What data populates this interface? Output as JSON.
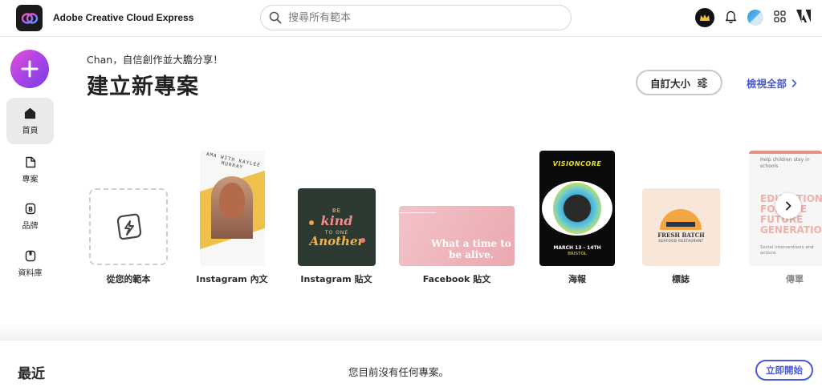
{
  "app": {
    "title": "Adobe Creative Cloud Express"
  },
  "search": {
    "placeholder": "搜尋所有範本"
  },
  "topbar": {
    "icons": [
      "crown-icon",
      "bell-icon",
      "avatar",
      "apps-grid-icon",
      "adobe-logo-icon"
    ]
  },
  "sidebar": {
    "items": [
      {
        "label": "首頁",
        "icon": "home-icon",
        "active": true
      },
      {
        "label": "專案",
        "icon": "file-icon",
        "active": false
      },
      {
        "label": "品牌",
        "icon": "brand-icon",
        "active": false
      },
      {
        "label": "資料庫",
        "icon": "library-icon",
        "active": false
      }
    ]
  },
  "header": {
    "greeting": "Chan，自信創作並大膽分享！",
    "title": "建立新專案",
    "custom_size_label": "自訂大小",
    "view_all_label": "檢視全部"
  },
  "templates": [
    {
      "label": "從您的範本"
    },
    {
      "label": "Instagram 內文",
      "thumb_text": "AMA WITH KAYLEE MURRAY"
    },
    {
      "label": "Instagram 貼文",
      "thumb_text_top": "BE",
      "thumb_text_main": "kind",
      "thumb_text_mid": "TO ONE",
      "thumb_text_bottom": "Another"
    },
    {
      "label": "Facebook 貼文",
      "thumb_text": "What a time to be alive."
    },
    {
      "label": "海報",
      "thumb_text_top": "VISIONCORE",
      "thumb_text_bottom": "MARCH 13 - 14TH",
      "thumb_text_sub": "BRISTOL"
    },
    {
      "label": "標誌",
      "thumb_text_main": "FRESH BATCH",
      "thumb_text_sub": "SEAFOOD RESTAURANT"
    },
    {
      "label": "傳單",
      "thumb_text_top": "Help children stay in schools",
      "thumb_text_main": "EDUCATION FOR THE FUTURE GENERATION",
      "thumb_text_bottom": "Social interventions and actions"
    }
  ],
  "recent": {
    "title": "最近",
    "empty_message": "您目前沒有任何專案。",
    "start_label": "立即開始"
  },
  "colors": {
    "accent": "#4a58d8",
    "create_gradient_start": "#e54fd7",
    "create_gradient_end": "#7b3fe4"
  }
}
